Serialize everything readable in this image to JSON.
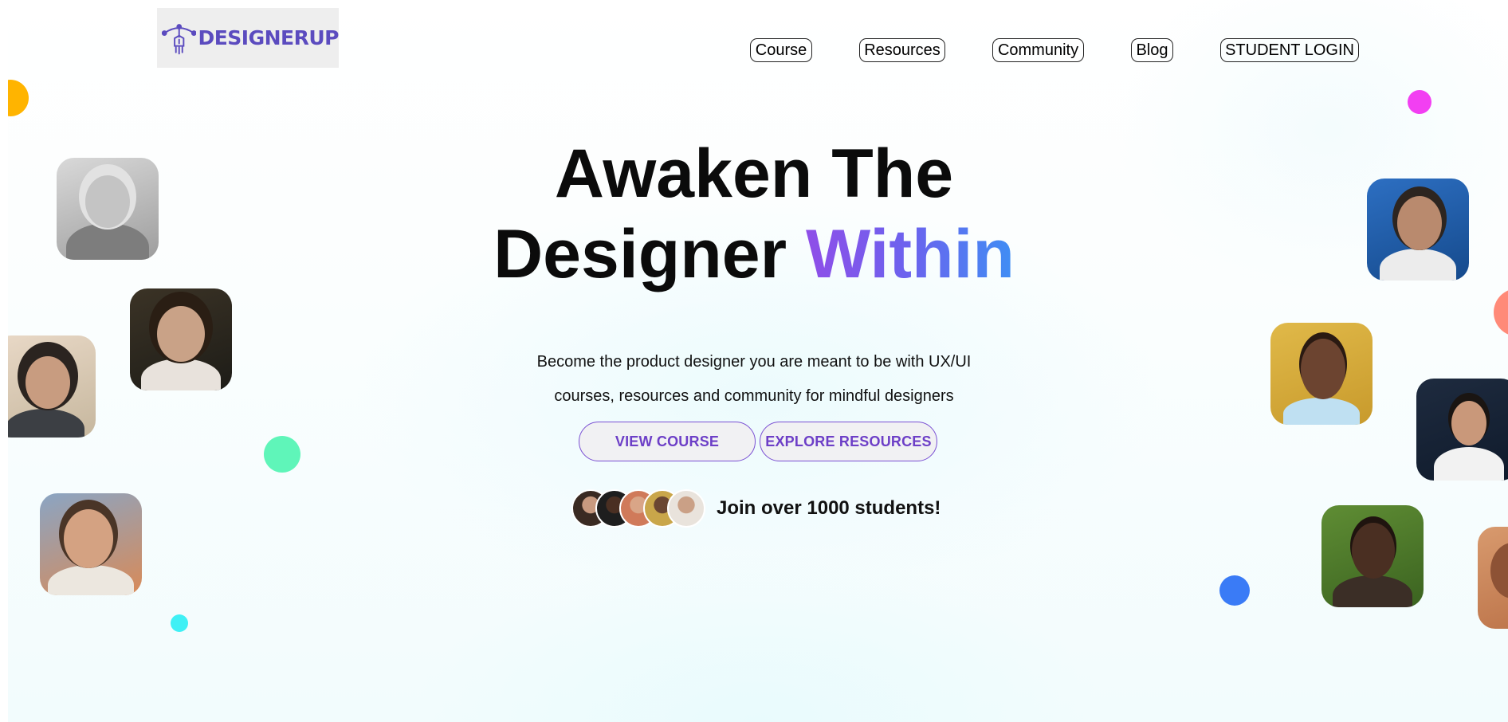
{
  "header": {
    "logo_text": "DESIGNERUP",
    "nav": [
      {
        "label": "Course"
      },
      {
        "label": "Resources"
      },
      {
        "label": "Community"
      },
      {
        "label": "Blog"
      },
      {
        "label": "STUDENT LOGIN"
      }
    ]
  },
  "hero": {
    "title_line1": "Awaken The",
    "title_line2_plain": "Designer",
    "title_line2_accent": "Within",
    "subtitle_line1": "Become the product designer you are meant to be with UX/UI",
    "subtitle_line2": "courses, resources and community for mindful designers",
    "cta_primary": "VIEW COURSE",
    "cta_secondary": "EXPLORE RESOURCES",
    "students_text": "Join over 1000 students!"
  },
  "colors": {
    "brand_purple": "#5b4bbf",
    "cta_text": "#6d3fc7",
    "gradient_start": "#8f4ee8",
    "gradient_end": "#3f8ef4"
  }
}
